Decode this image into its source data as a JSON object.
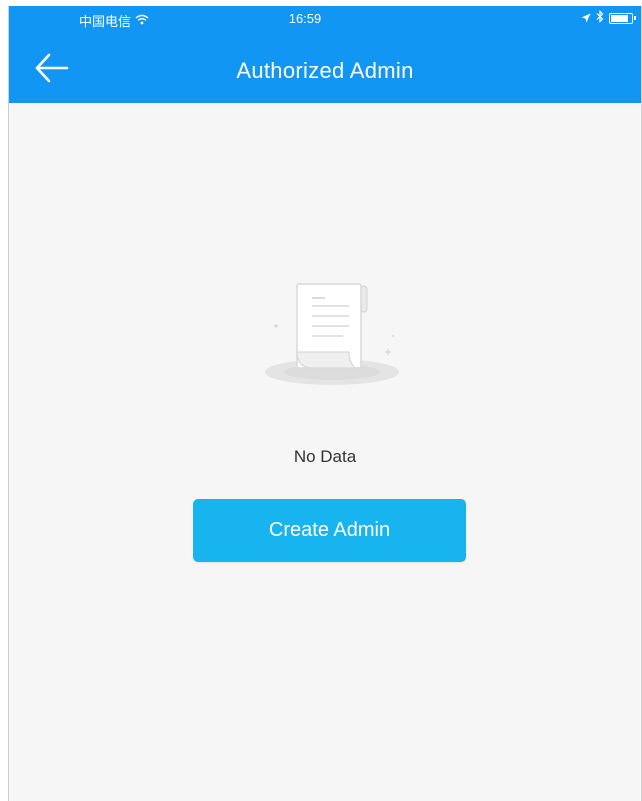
{
  "status_bar": {
    "carrier": "中国电信",
    "time": "16:59",
    "icons": [
      "wifi-icon",
      "location-arrow-icon",
      "bluetooth-icon",
      "battery-icon"
    ]
  },
  "nav": {
    "title": "Authorized Admin",
    "back_icon": "arrow-left-icon"
  },
  "empty_state": {
    "illustration": "empty-document-icon",
    "message": "No Data"
  },
  "actions": {
    "create_label": "Create Admin"
  },
  "colors": {
    "header": "#1296f3",
    "button": "#18b4ef",
    "background": "#f6f6f6"
  }
}
